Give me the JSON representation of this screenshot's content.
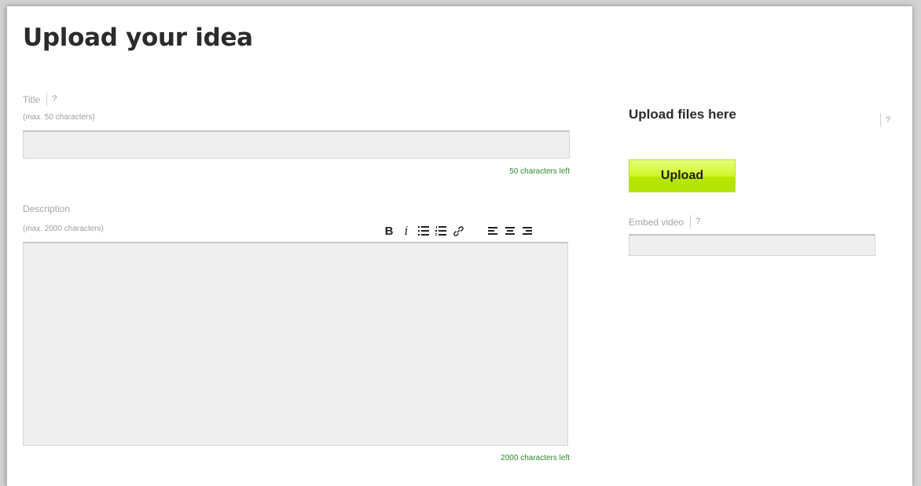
{
  "page": {
    "title": "Upload your idea"
  },
  "title_field": {
    "label": "Title",
    "help": "?",
    "hint": "(max. 50 characters)",
    "value": "",
    "counter": "50 characters left"
  },
  "description_field": {
    "label": "Description",
    "hint": "(max. 2000 characters)",
    "value": "",
    "counter": "2000 characters left",
    "toolbar": {
      "bold": "B",
      "italic": "i",
      "bullet_list_icon": "bulleted-list-icon",
      "numbered_list_icon": "numbered-list-icon",
      "link_icon": "link-icon",
      "align_left_icon": "align-left-icon",
      "align_center_icon": "align-center-icon",
      "align_right_icon": "align-right-icon"
    }
  },
  "files": {
    "title": "Upload files here",
    "help": "?",
    "upload_label": "Upload"
  },
  "video": {
    "label": "Embed video",
    "help": "?",
    "value": ""
  },
  "colors": {
    "counter_text": "#2f8a2f",
    "upload_button_top": "#e6ff7a",
    "upload_button_bottom": "#b3e400",
    "input_bg": "#efefef"
  }
}
